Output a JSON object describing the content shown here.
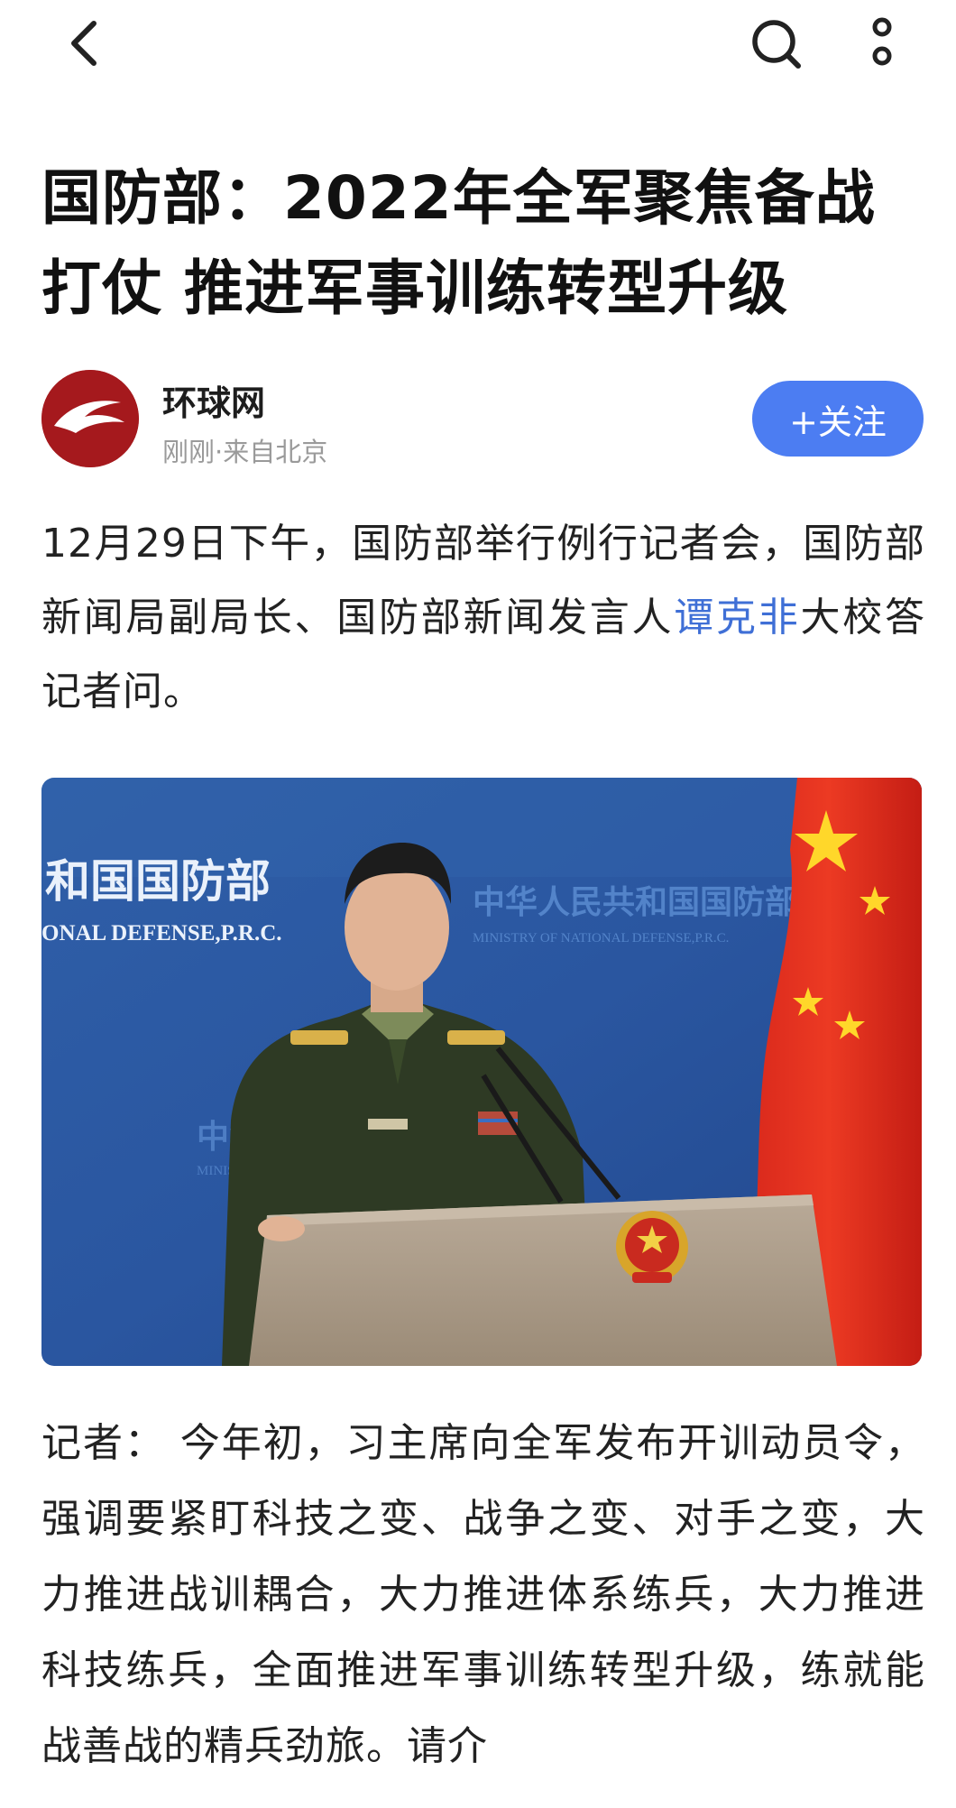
{
  "icons": {
    "back": "chevron-left-icon",
    "search": "search-icon",
    "more": "more-vertical-icon"
  },
  "colors": {
    "accent": "#4c7df2",
    "link": "#3f6fd6",
    "avatar_bg": "#a5191d",
    "meta_text": "#9a9a9a"
  },
  "article": {
    "title": "国防部：2022年全军聚焦备战打仗 推进军事训练转型升级"
  },
  "author": {
    "name": "环球网",
    "meta": "刚刚·来自北京",
    "follow_label": "+关注"
  },
  "content": {
    "p1_before": "12月29日下午，国防部举行例行记者会，国防部新闻局副局长、国防部新闻发言人",
    "p1_link": "谭克非",
    "p1_after": "大校答记者问。",
    "photo": {
      "backdrop_cn_left": "和国国防部",
      "backdrop_en_left": "ONAL DEFENSE,P.R.C.",
      "backdrop_cn_right": "中华人民共和国国防部",
      "backdrop_en_right": "MINISTRY OF NATIONAL DEFENSE,P.R.C.",
      "backdrop_cn_lower": "中华",
      "backdrop_en_lower": "MINIS"
    },
    "p2": "记者： 今年初，习主席向全军发布开训动员令，强调要紧盯科技之变、战争之变、对手之变，大力推进战训耦合，大力推进体系练兵，大力推进科技练兵，全面推进军事训练转型升级，练就能战善战的精兵劲旅。请介"
  }
}
